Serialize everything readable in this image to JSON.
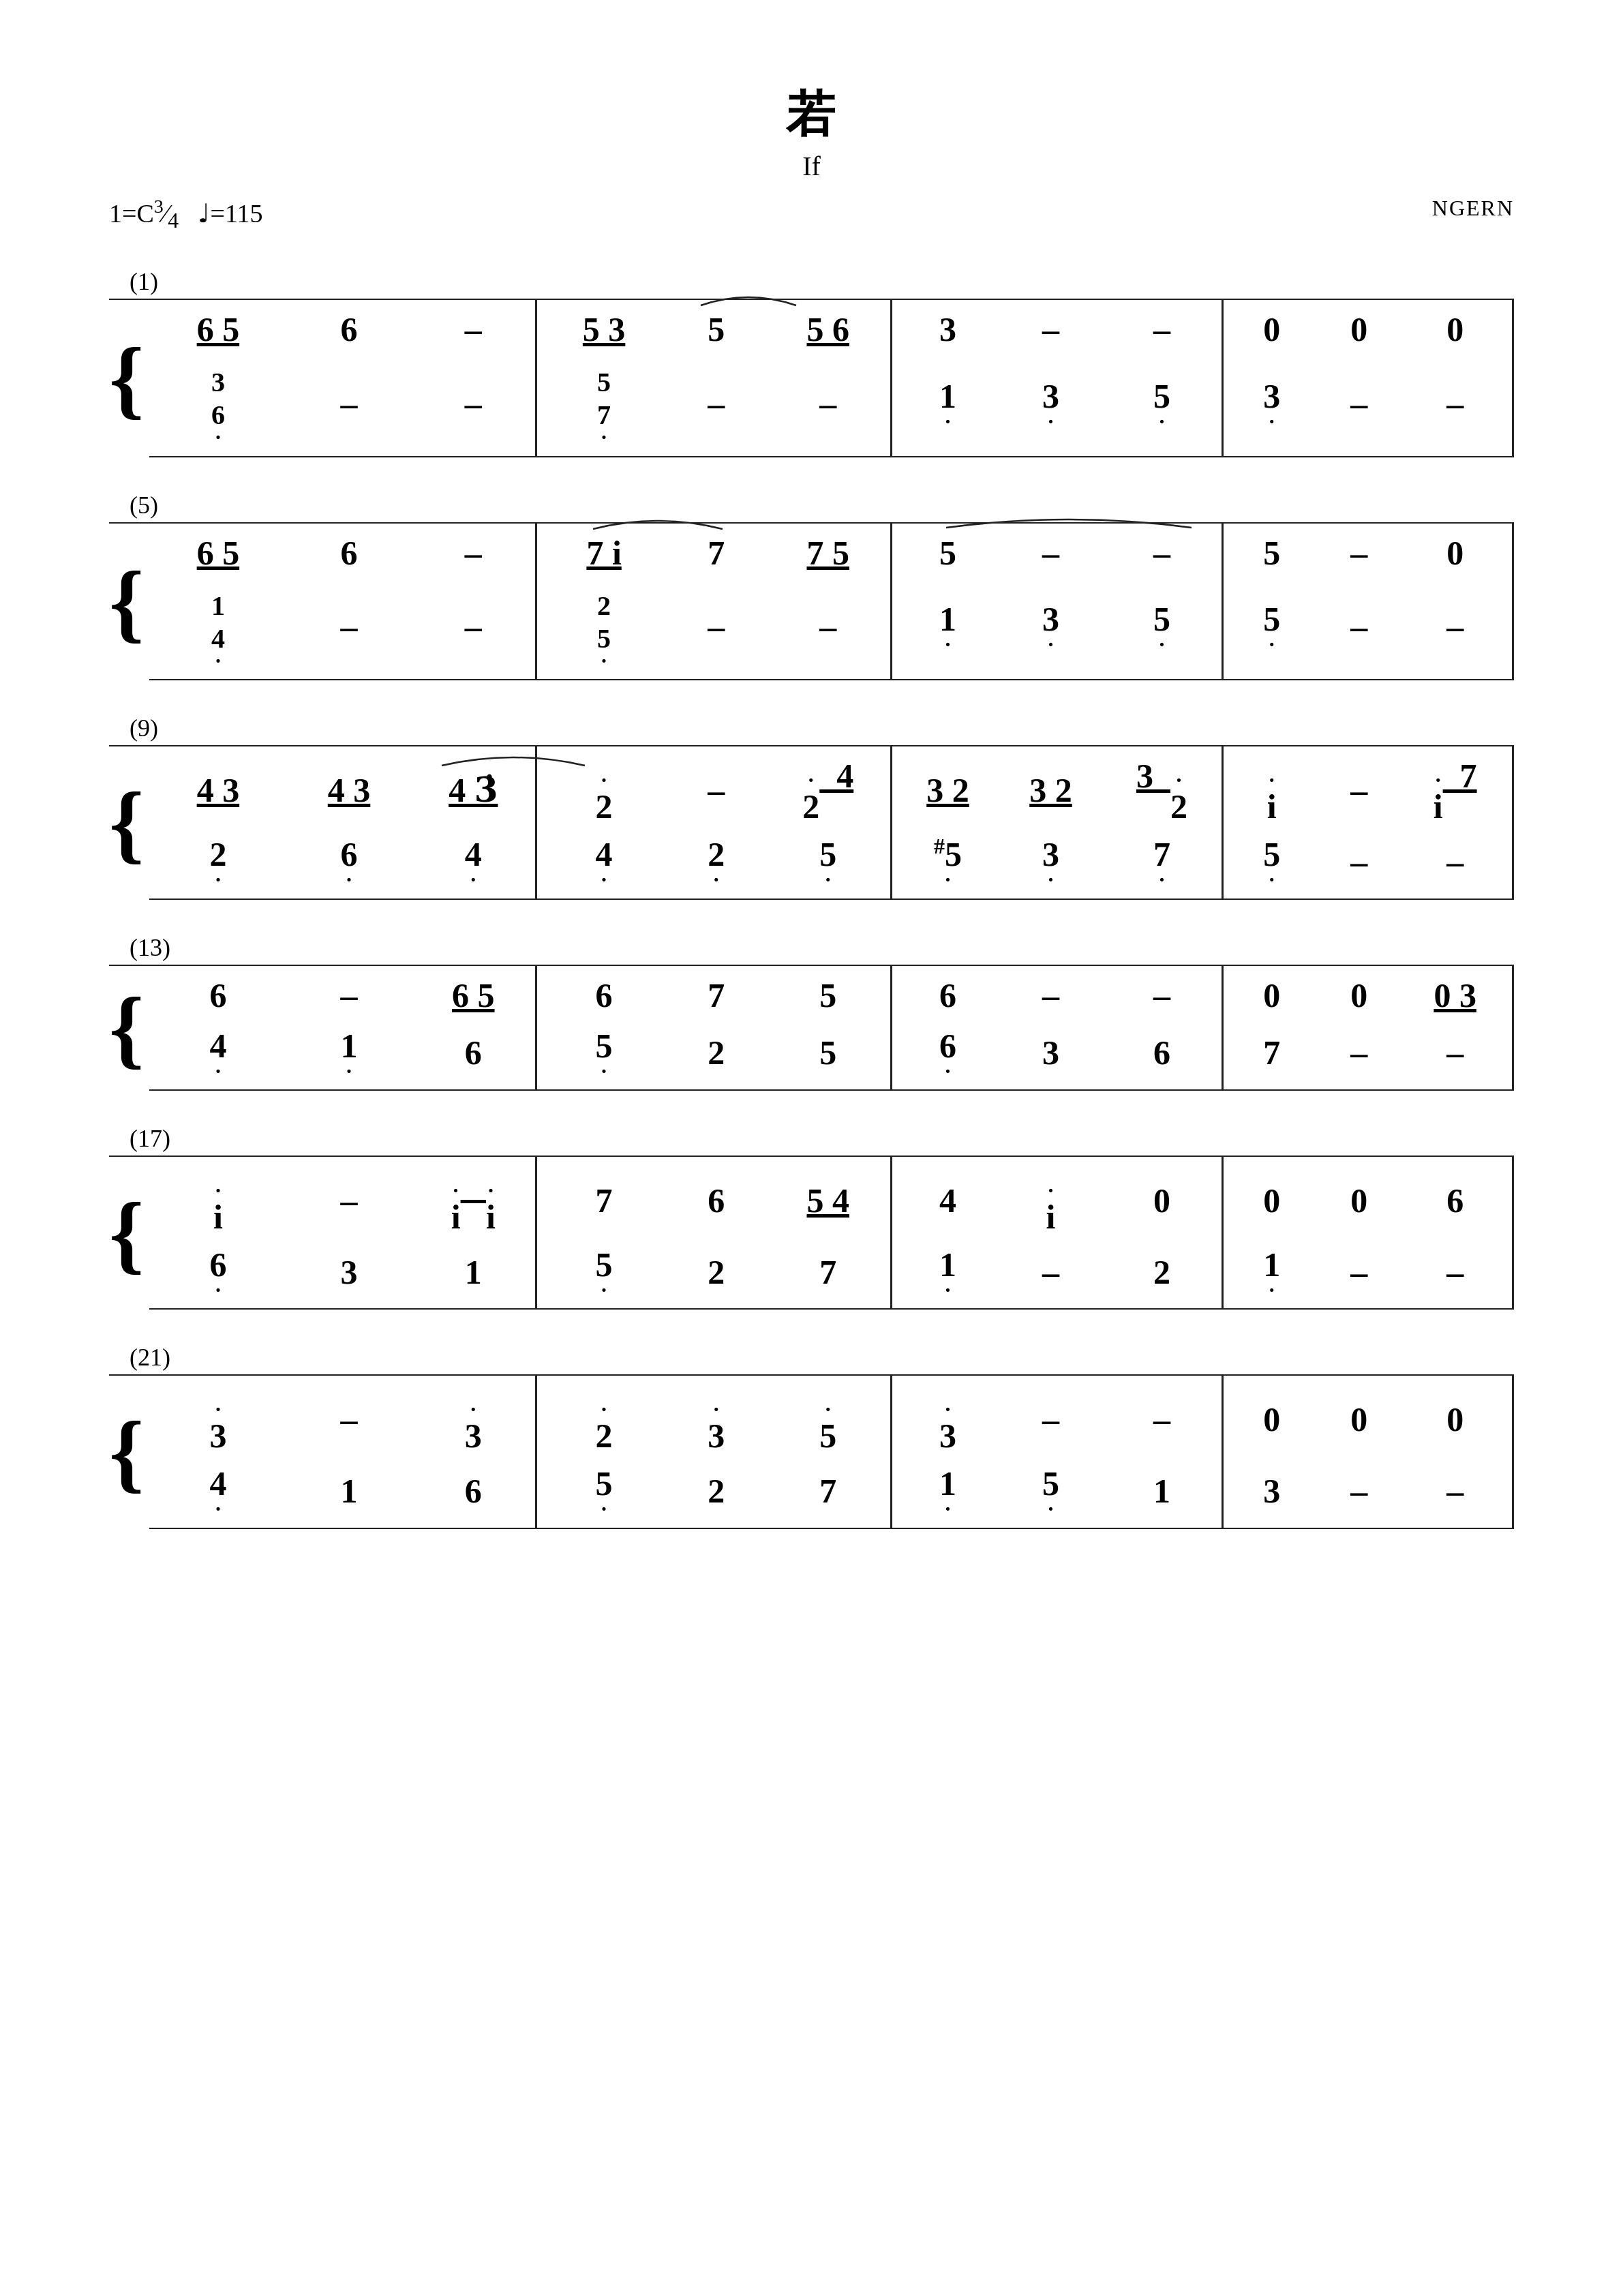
{
  "title": {
    "chinese": "若",
    "english": "If"
  },
  "meta": {
    "key": "1=C",
    "time": "3/4",
    "tempo": "♩=115",
    "composer": "NGERN"
  },
  "sections": [
    {
      "number": "(1)",
      "upper": [
        {
          "type": "bar",
          "notes": [
            "6̲ 5̲",
            "6",
            "–"
          ]
        },
        {
          "type": "bar",
          "notes": [
            "5̲ 3̲",
            "5",
            "5̲ 6̲"
          ]
        },
        {
          "type": "bar",
          "notes": [
            "3",
            "–",
            "–"
          ]
        },
        {
          "type": "bar",
          "notes": [
            "0",
            "0",
            "0"
          ]
        }
      ],
      "lower": [
        {
          "type": "bar",
          "notes": [
            "3/6·",
            "–",
            "–"
          ]
        },
        {
          "type": "bar",
          "notes": [
            "5/7·",
            "–",
            "–"
          ]
        },
        {
          "type": "bar",
          "notes": [
            "1·",
            "3·",
            "5·"
          ]
        },
        {
          "type": "bar",
          "notes": [
            "3·",
            "–",
            "–"
          ]
        }
      ]
    }
  ]
}
